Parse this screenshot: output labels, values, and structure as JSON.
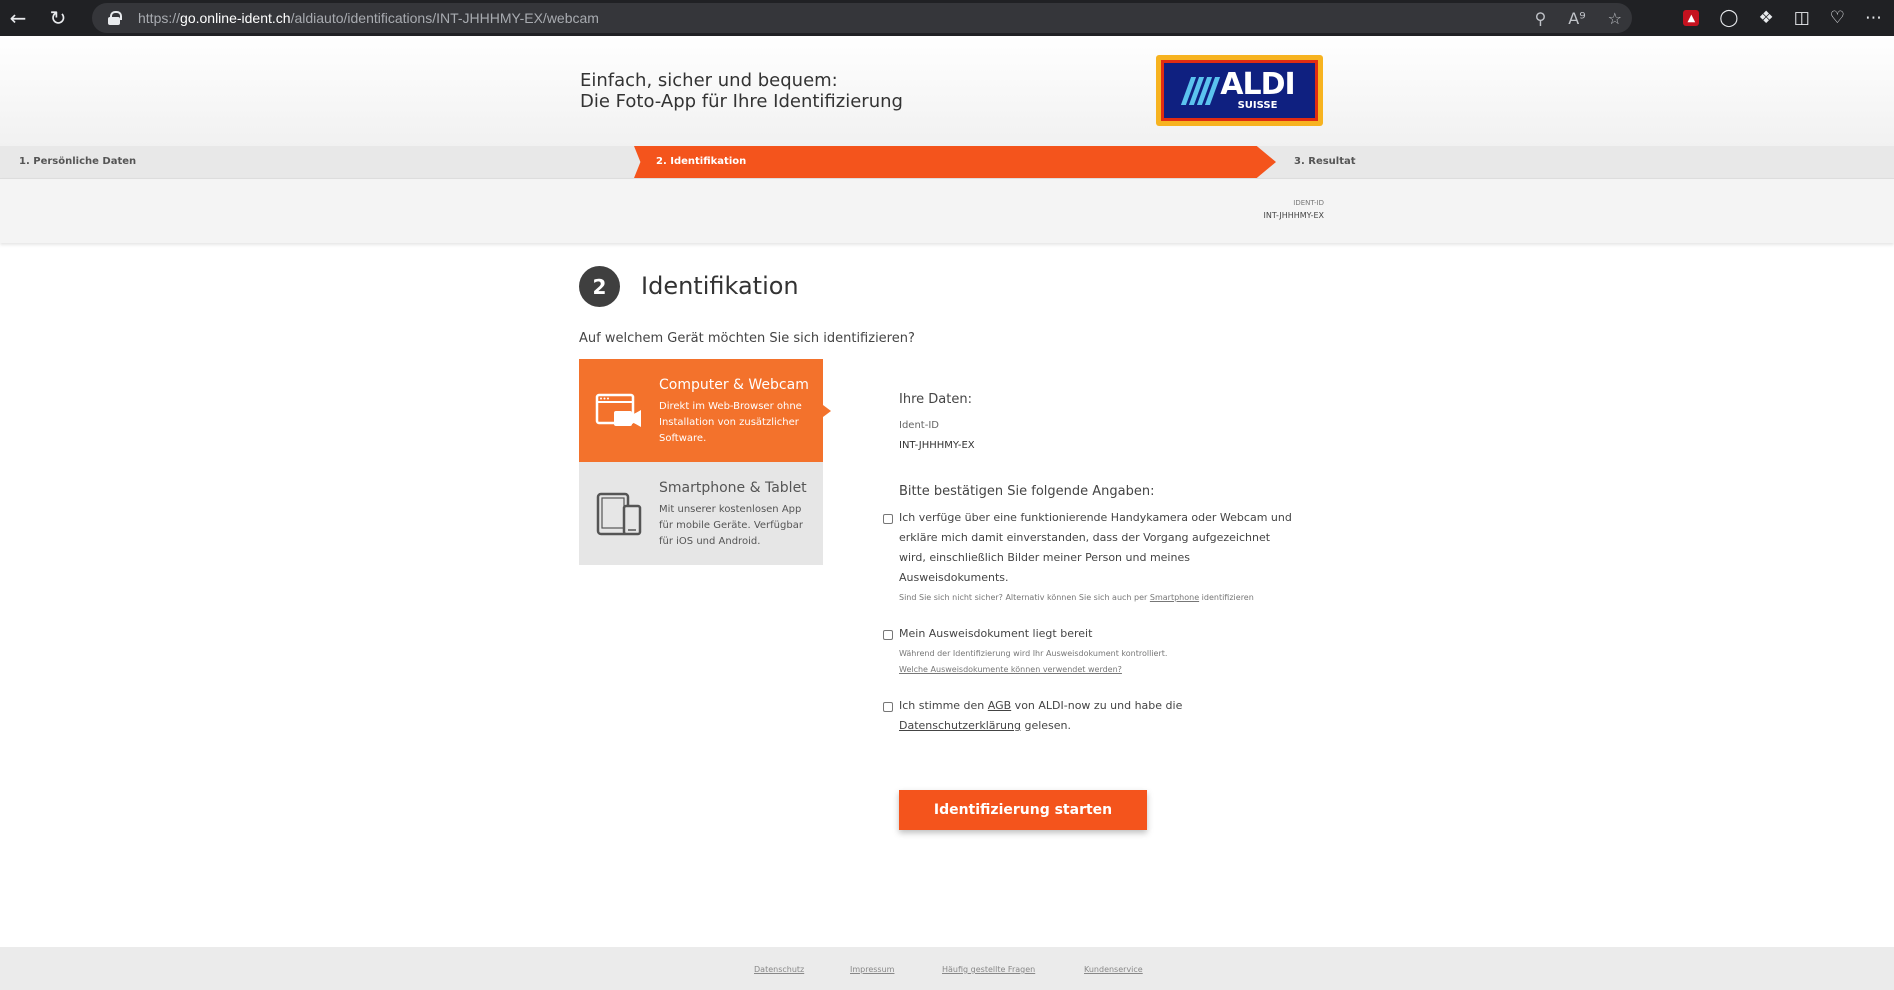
{
  "browser": {
    "url_scheme": "https://",
    "url_host": "go.online-ident.ch",
    "url_path": "/aldiauto/identifications/INT-JHHHMY-EX/webcam"
  },
  "header": {
    "line1": "Einfach, sicher und bequem:",
    "line2": "Die Foto-App für Ihre Identifizierung",
    "logo_word": "ALDI",
    "logo_sub": "SUISSE"
  },
  "steps": [
    {
      "label": "1. Persönliche Daten"
    },
    {
      "label": "2. Identifikation"
    },
    {
      "label": "3. Resultat"
    }
  ],
  "ident": {
    "label": "IDENT-ID",
    "value": "INT-JHHHMY-EX"
  },
  "main": {
    "step_number": "2",
    "title": "Identifikation",
    "question": "Auf welchem Gerät möchten Sie sich identifizieren?"
  },
  "devices": [
    {
      "title": "Computer & Webcam",
      "desc": "Direkt im Web-Browser ohne Installation von zusätzlicher Software."
    },
    {
      "title": "Smartphone & Tablet",
      "desc": "Mit unserer kostenlosen App für mobile Geräte. Verfügbar für iOS und Android."
    }
  ],
  "data": {
    "heading": "Ihre Daten:",
    "ident_label": "Ident-ID",
    "ident_value": "INT-JHHHMY-EX",
    "confirm_heading": "Bitte bestätigen Sie folgende Angaben:"
  },
  "checks": [
    {
      "line1": "Ich verfüge über eine funktionierende Handykamera oder Webcam und",
      "line2": "erkläre mich damit einverstanden, dass der Vorgang aufgezeichnet",
      "line3": "wird, einschließlich Bilder meiner Person und meines",
      "line4": "Ausweisdokuments.",
      "sub_prefix": "Sind Sie sich nicht sicher? Alternativ können Sie sich auch per ",
      "sub_link": "Smartphone",
      "sub_suffix": " identifizieren"
    },
    {
      "line1": "Mein Ausweisdokument liegt bereit",
      "sub": "Während der Identifizierung wird Ihr Ausweisdokument kontrolliert.",
      "sub_link": "Welche Ausweisdokumente können verwendet werden?"
    },
    {
      "pre": "Ich stimme den ",
      "link1": "AGB",
      "mid": " von ALDI-now zu und habe die",
      "link2": "Datenschutzerklärung",
      "post": " gelesen."
    }
  ],
  "start_button": "Identifizierung starten",
  "footer": [
    "Datenschutz",
    "Impressum",
    "Häufig gestellte Fragen",
    "Kundenservice"
  ],
  "colors": {
    "accent": "#f4541c",
    "device_active": "#f3722c",
    "dark_circle": "#3f3f3f"
  }
}
